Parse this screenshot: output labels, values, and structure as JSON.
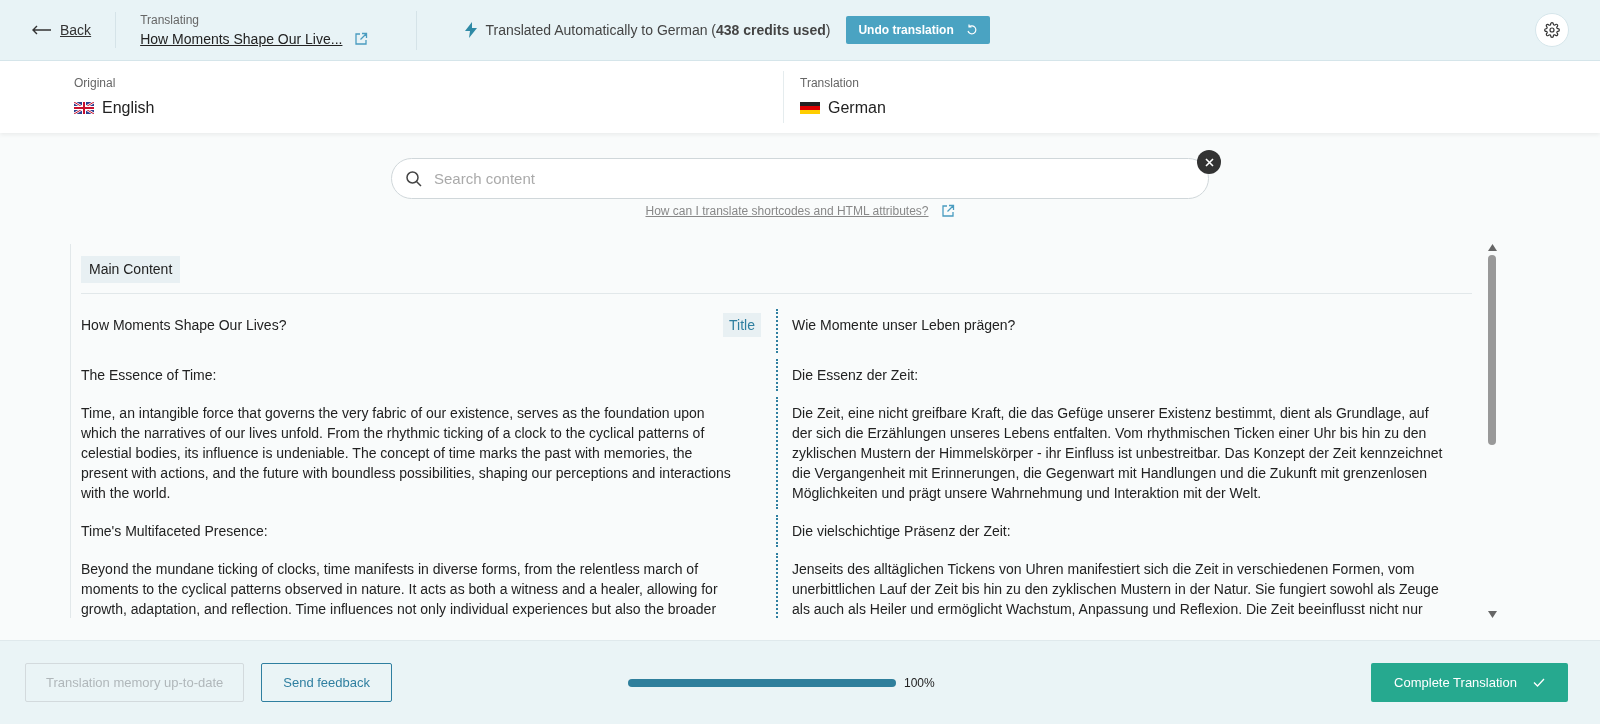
{
  "header": {
    "back": "Back",
    "translating_label": "Translating",
    "post_title": "How Moments Shape Our Live...",
    "status": "Translated Automatically to German (**438 credits used**)",
    "undo_button": "Undo translation"
  },
  "languages": {
    "original_label": "Original",
    "original": "English",
    "translation_label": "Translation",
    "translation": "German"
  },
  "search": {
    "placeholder": "Search content",
    "help_link": "How can I translate shortcodes and HTML attributes?"
  },
  "section": "Main Content",
  "segments": [
    {
      "source": "How Moments Shape Our Lives?",
      "tag": "Title",
      "target": "Wie Momente unser Leben prägen?"
    },
    {
      "source": "The Essence of Time:",
      "target": "Die Essenz der Zeit:"
    },
    {
      "source": "Time, an intangible force that governs the very fabric of our existence, serves as the foundation upon which the narratives of our lives unfold. From the rhythmic ticking of a clock to the cyclical patterns of celestial bodies, its influence is undeniable. The concept of time marks the past with memories, the present with actions, and the future with boundless possibilities, shaping our perceptions and interactions with the world.",
      "target": "Die Zeit, eine nicht greifbare Kraft, die das Gefüge unserer Existenz bestimmt, dient als Grundlage, auf der sich die Erzählungen unseres Lebens entfalten. Vom rhythmischen Ticken einer Uhr bis hin zu den zyklischen Mustern der Himmelskörper - ihr Einfluss ist unbestreitbar. Das Konzept der Zeit kennzeichnet die Vergangenheit mit Erinnerungen, die Gegenwart mit Handlungen und die Zukunft mit grenzenlosen Möglichkeiten und prägt unsere Wahrnehmung und Interaktion mit der Welt."
    },
    {
      "source": "Time's Multifaceted Presence:",
      "target": "Die vielschichtige Präsenz der Zeit:"
    },
    {
      "source": "Beyond the mundane ticking of clocks, time manifests in diverse forms, from the relentless march of moments to the cyclical patterns observed in nature. It acts as both a witness and a healer, allowing for growth, adaptation, and reflection. Time influences not only individual experiences but also the broader",
      "target": "Jenseits des alltäglichen Tickens von Uhren manifestiert sich die Zeit in verschiedenen Formen, vom unerbittlichen Lauf der Zeit bis hin zu den zyklischen Mustern in der Natur. Sie fungiert sowohl als Zeuge als auch als Heiler und ermöglicht Wachstum, Anpassung und Reflexion. Die Zeit beeinflusst nicht nur"
    }
  ],
  "footer": {
    "memory_button": {
      "label": "Translation memory up-to-date",
      "disabled": true
    },
    "feedback_button": "Send feedback",
    "progress": {
      "level": 1.0,
      "reading": "100%"
    },
    "complete_button": "Complete Translation"
  }
}
